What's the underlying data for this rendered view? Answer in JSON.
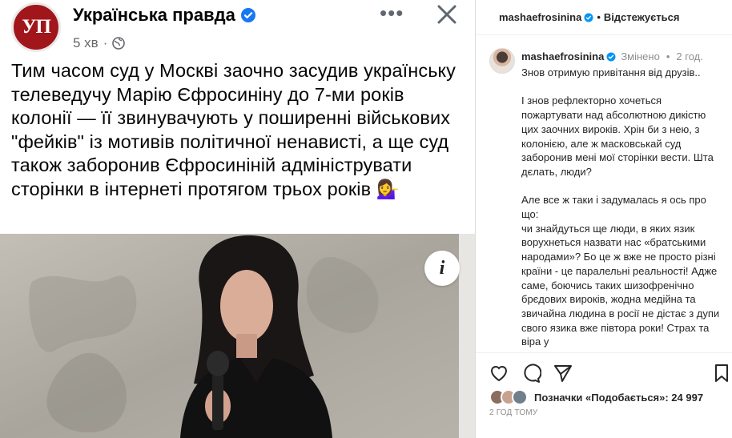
{
  "facebook_post": {
    "page_name": "Українська правда",
    "avatar_text": "УП",
    "time": "5 хв",
    "separator": "·",
    "text": "Тим часом суд у Москві заочно засудив українську телеведучу Марію Єфросиніну до 7-ми років колонії — її звинувачують у поширенні військових \"фейків\" із мотивів політичної ненависті, а ще суд також заборонив Єфросиніній адмініструвати сторінки в інтернеті протягом трьох років 💁‍♀️",
    "info_icon_label": "i"
  },
  "instagram": {
    "header": {
      "username": "mashaefrosinina",
      "dot": "•",
      "follow_status": "Відстежується"
    },
    "comment": {
      "username": "mashaefrosinina",
      "edited": "Змінено",
      "dot": "•",
      "time": "2 год.",
      "paragraphs": [
        "Знов отримую привітання від друзів..",
        "",
        "І знов рефлекторно хочеться пожартувати над абсолютною дикістю цих заочних вироків. Хрін би з нею, з колонією, але ж масковськай суд заборонив мені мої сторінки вести. Шта дєлать, люди?",
        "",
        "Але все ж таки і задумалась я ось про що:",
        "чи знайдуться ще люди, в яких язик ворухнеться назвати нас «братськими народами»? Бо це ж вже не просто різні країни - це паралельні реальності! Адже саме, боючись таких шизофренічно брєдових вироків, жодна медійна та звичайна людина в росії не дістає з дупи свого язика вже півтора роки! Страх та віра у"
      ]
    },
    "likes_text": "Позначки «Подобається»: 24 997",
    "timestamp": "2 ГОД ТОМУ"
  },
  "colors": {
    "verified_blue": "#0095f6",
    "fb_verified_blue": "#1877f2",
    "up_red": "#a1161b"
  }
}
